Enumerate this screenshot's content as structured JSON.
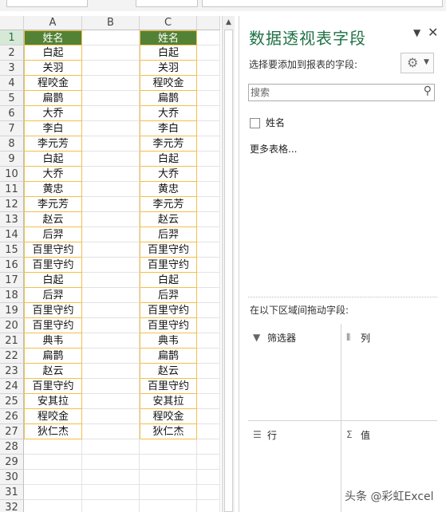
{
  "sheet": {
    "columns": [
      "A",
      "B",
      "C"
    ],
    "selected_row": "1",
    "header": "姓名",
    "rows": [
      {
        "n": "1",
        "a": "姓名",
        "c": "姓名"
      },
      {
        "n": "2",
        "a": "白起",
        "c": "白起"
      },
      {
        "n": "3",
        "a": "关羽",
        "c": "关羽"
      },
      {
        "n": "4",
        "a": "程咬金",
        "c": "程咬金"
      },
      {
        "n": "5",
        "a": "扁鹊",
        "c": "扁鹊"
      },
      {
        "n": "6",
        "a": "大乔",
        "c": "大乔"
      },
      {
        "n": "7",
        "a": "李白",
        "c": "李白"
      },
      {
        "n": "8",
        "a": "李元芳",
        "c": "李元芳"
      },
      {
        "n": "9",
        "a": "白起",
        "c": "白起"
      },
      {
        "n": "10",
        "a": "大乔",
        "c": "大乔"
      },
      {
        "n": "11",
        "a": "黄忠",
        "c": "黄忠"
      },
      {
        "n": "12",
        "a": "李元芳",
        "c": "李元芳"
      },
      {
        "n": "13",
        "a": "赵云",
        "c": "赵云"
      },
      {
        "n": "14",
        "a": "后羿",
        "c": "后羿"
      },
      {
        "n": "15",
        "a": "百里守约",
        "c": "百里守约"
      },
      {
        "n": "16",
        "a": "百里守约",
        "c": "百里守约"
      },
      {
        "n": "17",
        "a": "白起",
        "c": "白起"
      },
      {
        "n": "18",
        "a": "后羿",
        "c": "后羿"
      },
      {
        "n": "19",
        "a": "百里守约",
        "c": "百里守约"
      },
      {
        "n": "20",
        "a": "百里守约",
        "c": "百里守约"
      },
      {
        "n": "21",
        "a": "典韦",
        "c": "典韦"
      },
      {
        "n": "22",
        "a": "扁鹊",
        "c": "扁鹊"
      },
      {
        "n": "23",
        "a": "赵云",
        "c": "赵云"
      },
      {
        "n": "24",
        "a": "百里守约",
        "c": "百里守约"
      },
      {
        "n": "25",
        "a": "安其拉",
        "c": "安其拉"
      },
      {
        "n": "26",
        "a": "程咬金",
        "c": "程咬金"
      },
      {
        "n": "27",
        "a": "狄仁杰",
        "c": "狄仁杰"
      },
      {
        "n": "28",
        "a": "",
        "c": ""
      },
      {
        "n": "29",
        "a": "",
        "c": ""
      },
      {
        "n": "30",
        "a": "",
        "c": ""
      },
      {
        "n": "31",
        "a": "",
        "c": ""
      },
      {
        "n": "32",
        "a": "",
        "c": ""
      }
    ]
  },
  "pivot": {
    "title": "数据透视表字段",
    "choose_label": "选择要添加到报表的字段:",
    "search_placeholder": "搜索",
    "fields": [
      {
        "label": "姓名",
        "checked": false
      }
    ],
    "more_tables": "更多表格...",
    "drag_label": "在以下区域间拖动字段:",
    "areas": {
      "filters": "筛选器",
      "columns": "列",
      "rows": "行",
      "values": "值"
    },
    "icons": {
      "menu": "chevron-down-icon",
      "close": "close-icon",
      "tools": "gear-icon",
      "search": "search-icon",
      "filters": "filter-icon",
      "columns": "columns-icon",
      "rows": "rows-icon",
      "values": "sigma-icon"
    }
  },
  "watermark": "头条 @彩虹Excel",
  "colors": {
    "header_fill": "#548235",
    "cell_border": "#f0c04a",
    "accent": "#217346",
    "selected_header": "#d6e9d6"
  }
}
